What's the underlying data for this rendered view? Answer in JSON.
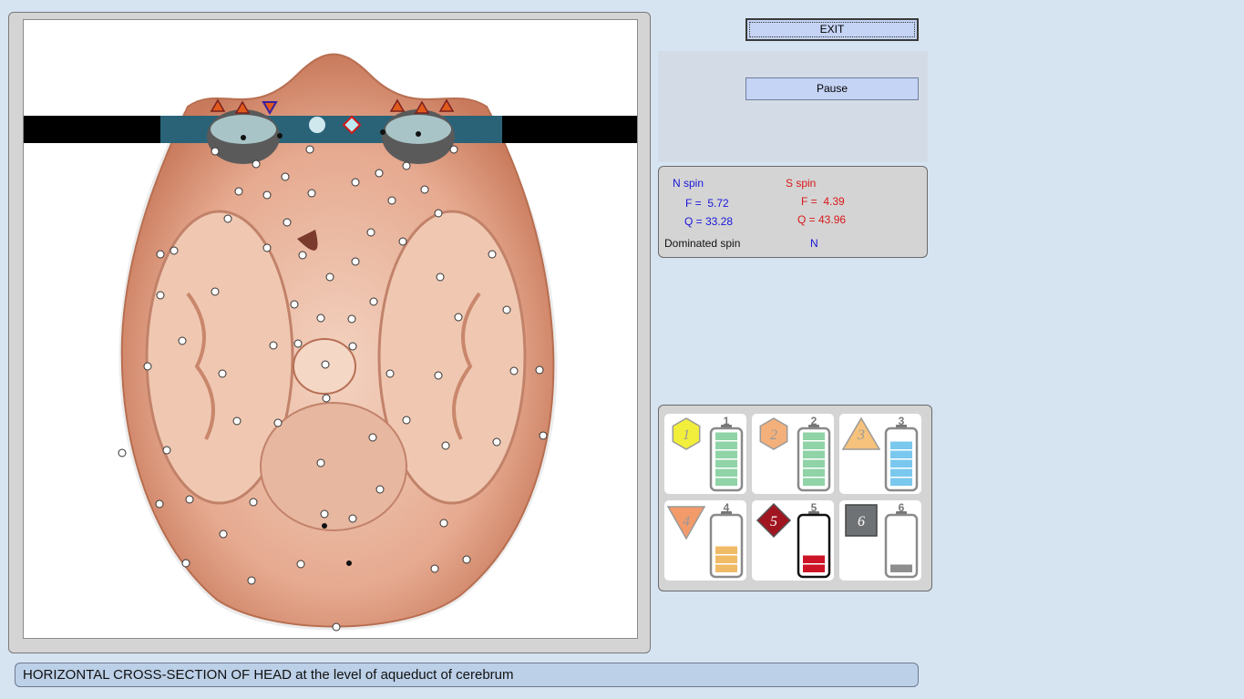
{
  "toolbar": {
    "exit_label": "EXIT",
    "pause_label": "Pause"
  },
  "spin": {
    "n_label": "N spin",
    "n_f": "F =  5.72",
    "n_q": "Q = 33.28",
    "s_label": "S spin",
    "s_f": "F =  4.39",
    "s_q": "Q = 43.96",
    "dominated_label": "Dominated spin",
    "dominated_value": "N"
  },
  "batteries": [
    {
      "id": "1",
      "shape": "hexagon",
      "color": "#f2ee3c",
      "level": 1.0,
      "fill": "#8fd3a6"
    },
    {
      "id": "2",
      "shape": "hexagon",
      "color": "#f4b07a",
      "level": 1.0,
      "fill": "#8fd3a6"
    },
    {
      "id": "3",
      "shape": "triangle-up",
      "color": "#f6c27c",
      "level": 0.75,
      "fill": "#7ac8ee"
    },
    {
      "id": "4",
      "shape": "triangle-down",
      "color": "#f29a6a",
      "level": 0.5,
      "fill": "#f0bb66"
    },
    {
      "id": "5",
      "shape": "diamond",
      "color": "#a01520",
      "level": 0.33,
      "fill": "#cc1426"
    },
    {
      "id": "6",
      "shape": "square",
      "color": "#6f7274",
      "level": 0.17,
      "fill": "#8e8e8e"
    }
  ],
  "caption": "HORIZONTAL CROSS-SECTION OF HEAD at the level of aqueduct of cerebrum",
  "colors": {
    "background": "#d6e3f1",
    "panel": "#d4d4d4",
    "button": "#c5d4f4",
    "tissue": "#e8b29a"
  },
  "icons": [
    "brain-cross-section-image",
    "marker-triangle-icon",
    "marker-diamond-icon",
    "battery-icon"
  ]
}
